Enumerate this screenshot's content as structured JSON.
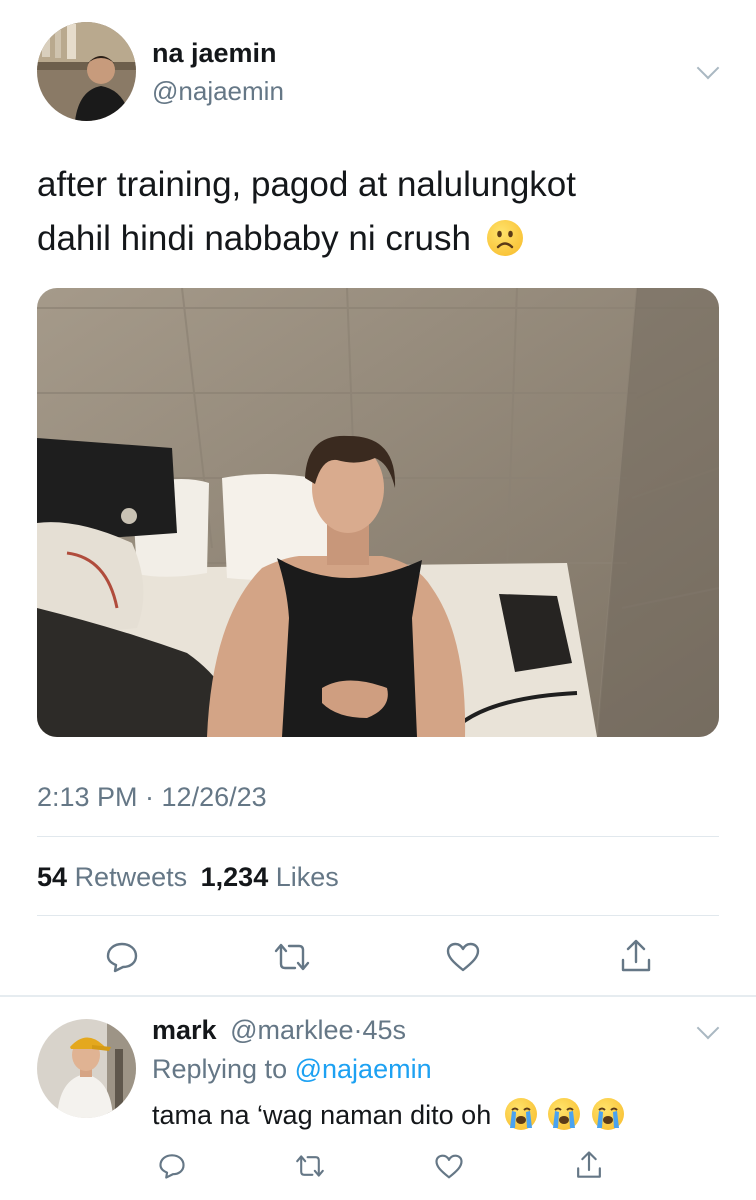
{
  "tweet": {
    "author_name": "na jaemin",
    "author_handle": "@najaemin",
    "text_line1": "after training, pagod at nalulungkot",
    "text_line2": "dahil hindi nabbaby ni crush",
    "emoji": "slightly-frowning-face",
    "timestamp": "2:13 PM · 12/26/23",
    "retweets_count": "54",
    "retweets_label": "Retweets",
    "likes_count": "1,234",
    "likes_label": "Likes"
  },
  "reply": {
    "author_name": "mark",
    "author_handle": "@marklee",
    "separator": "·",
    "time_ago": "45s",
    "replying_prefix": "Replying to",
    "replying_handle": "@najaemin",
    "text": "tama na ‘wag naman dito oh",
    "emojis": [
      "loudly-crying-face",
      "loudly-crying-face",
      "loudly-crying-face"
    ]
  },
  "icons": {
    "reply": "speech-bubble-icon",
    "retweet": "retweet-icon",
    "like": "heart-icon",
    "share": "share-icon",
    "more": "chevron-down-icon"
  },
  "colors": {
    "accent": "#1da1f2",
    "muted": "#657786",
    "divider": "#e1e8ed"
  }
}
